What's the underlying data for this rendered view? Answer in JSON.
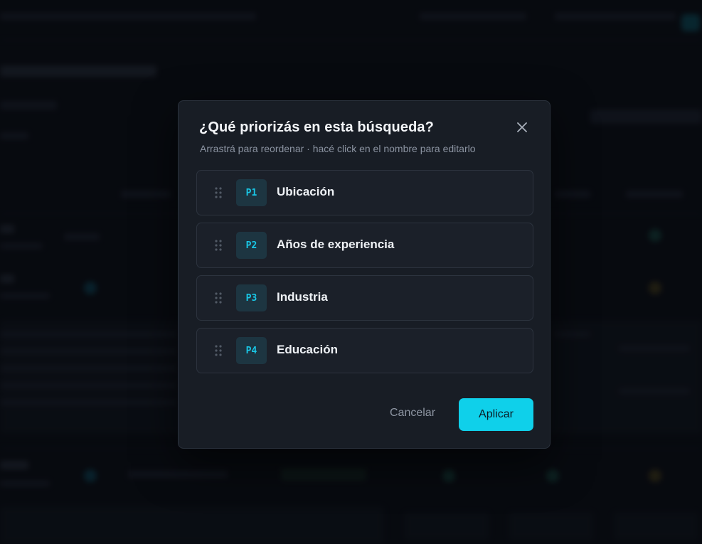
{
  "modal": {
    "title": "¿Qué priorizás en esta búsqueda?",
    "subtitle": "Arrastrá para reordenar · hacé click en el nombre para editarlo",
    "close_icon": "close-icon",
    "priorities": [
      {
        "badge": "P1",
        "label": "Ubicación"
      },
      {
        "badge": "P2",
        "label": "Años de experiencia"
      },
      {
        "badge": "P3",
        "label": "Industria"
      },
      {
        "badge": "P4",
        "label": "Educación"
      }
    ],
    "cancel_label": "Cancelar",
    "apply_label": "Aplicar"
  },
  "colors": {
    "accent": "#0fd0ea",
    "badge_text": "#19c7e6",
    "modal_bg": "#181d25",
    "item_bg": "#1b2029"
  }
}
